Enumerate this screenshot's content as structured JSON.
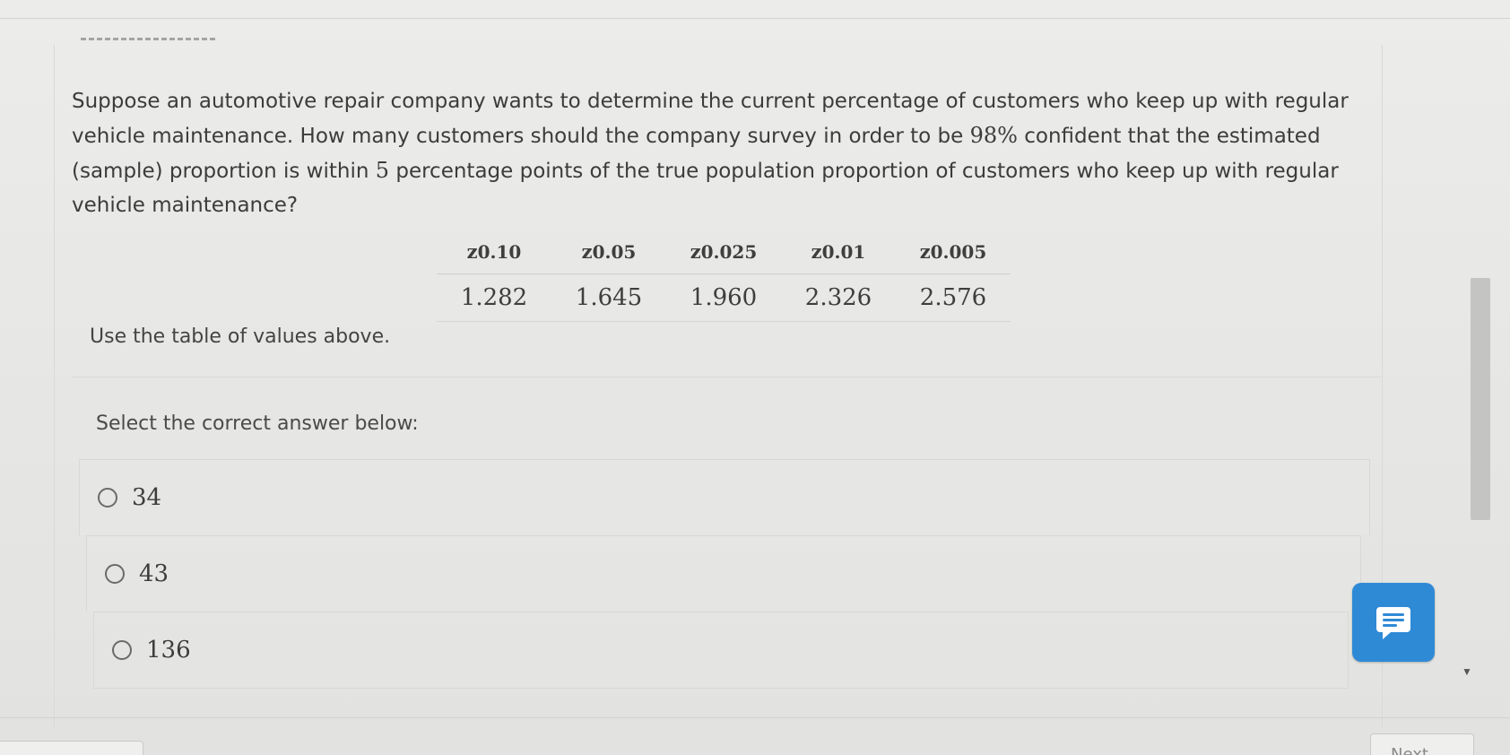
{
  "question": {
    "text_before_confidence": "Suppose an automotive repair company wants to determine the current percentage of customers who keep up with regular vehicle maintenance. How many customers should the company survey in order to be ",
    "confidence_value": "98%",
    "text_between": " confident that the estimated (sample) proportion is within ",
    "margin_value": "5",
    "text_after_margin": " percentage points of the true population proportion of customers who keep up with regular vehicle maintenance?"
  },
  "z_table": {
    "columns": [
      {
        "symbol": "z",
        "subscript": "0.10",
        "value": "1.282"
      },
      {
        "symbol": "z",
        "subscript": "0.05",
        "value": "1.645"
      },
      {
        "symbol": "z",
        "subscript": "0.025",
        "value": "1.960"
      },
      {
        "symbol": "z",
        "subscript": "0.01",
        "value": "2.326"
      },
      {
        "symbol": "z",
        "subscript": "0.005",
        "value": "2.576"
      }
    ]
  },
  "instruction": "Use the table of values above.",
  "answer_prompt": "Select the correct answer below:",
  "options": [
    {
      "label": "34",
      "selected": false
    },
    {
      "label": "43",
      "selected": false
    },
    {
      "label": "136",
      "selected": false
    }
  ],
  "navigation": {
    "next_label": "Next"
  },
  "feedback_button": {
    "icon": "message-lines-icon",
    "color": "#2f8ad6"
  }
}
